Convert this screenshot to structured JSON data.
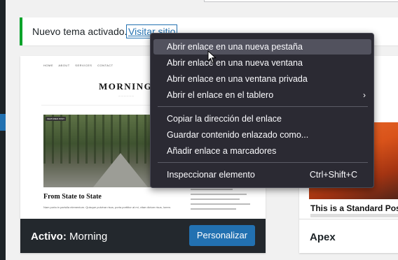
{
  "notice": {
    "text": "Nuevo tema activado.",
    "link": "Visitar sitio"
  },
  "active_theme": {
    "preview": {
      "nav": [
        "HOME",
        "ABOUT",
        "SERVICES",
        "CONTACT"
      ],
      "site_title": "MORNING",
      "badge": "FEATURED POST",
      "post_title": "From State to State",
      "post_text": "Nam porta in partulla elementum. Quisque pulvinar risus, porta porttitor at mi, vitae dictum risus, lorem."
    },
    "active_prefix": "Activo:",
    "name": "Morning",
    "customize_label": "Personalizar"
  },
  "other_theme": {
    "post_title": "This is a Standard Post",
    "name": "Apex"
  },
  "context_menu": {
    "items": [
      {
        "label": "Abrir enlace en una nueva pestaña",
        "hover": true
      },
      {
        "label": "Abrir enlace en una nueva ventana"
      },
      {
        "label": "Abrir enlace en una ventana privada"
      },
      {
        "label": "Abrir el enlace en el tablero",
        "submenu": true
      },
      {
        "label": "Copiar la dirección del enlace"
      },
      {
        "label": "Guardar contenido enlazado como..."
      },
      {
        "label": "Añadir enlace a marcadores"
      },
      {
        "label": "Inspeccionar elemento",
        "shortcut": "Ctrl+Shift+C"
      }
    ]
  },
  "colors": {
    "notice_border": "#00a32a",
    "primary": "#2271b1",
    "menu_bg": "#2b2a33",
    "menu_hover": "#52525e",
    "footer_dark": "#23282d"
  }
}
